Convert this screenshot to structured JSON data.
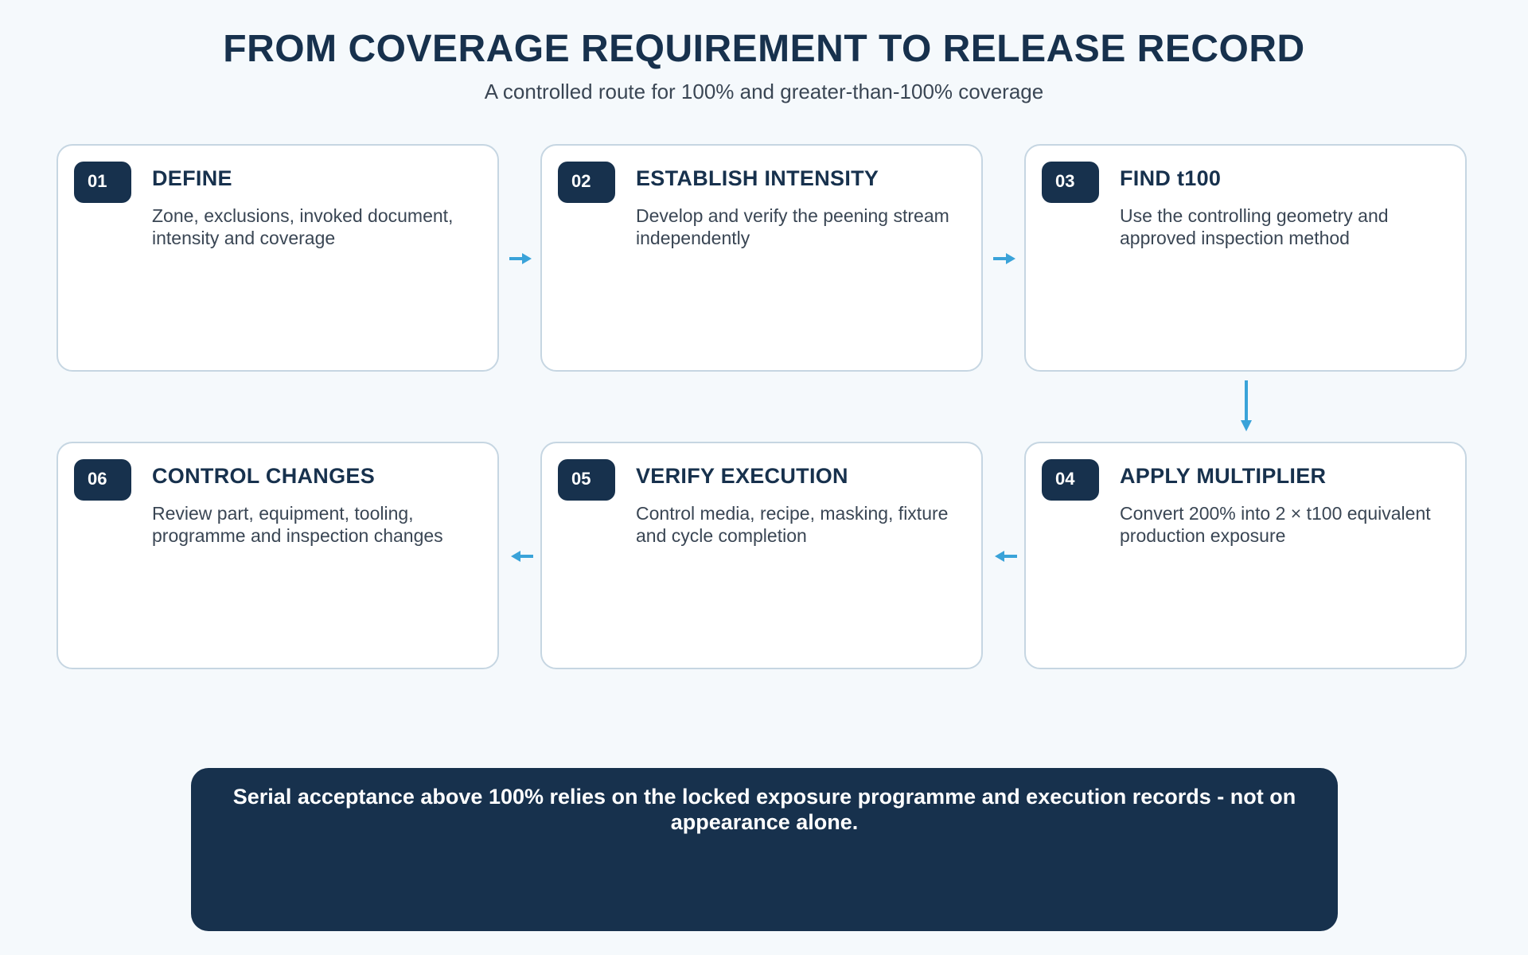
{
  "header": {
    "title": "FROM COVERAGE REQUIREMENT TO RELEASE RECORD",
    "subtitle": "A controlled route for 100% and greater-than-100% coverage"
  },
  "steps": [
    {
      "number": "01",
      "title": "DEFINE",
      "description": "Zone, exclusions, invoked document, intensity and coverage"
    },
    {
      "number": "02",
      "title": "ESTABLISH INTENSITY",
      "description": "Develop and verify the peening stream independently"
    },
    {
      "number": "03",
      "title": "FIND t100",
      "description": "Use the controlling geometry and approved inspection method"
    },
    {
      "number": "04",
      "title": "APPLY MULTIPLIER",
      "description": "Convert 200% into 2 × t100 equivalent production exposure"
    },
    {
      "number": "05",
      "title": "VERIFY EXECUTION",
      "description": "Control media, recipe, masking, fixture and cycle completion"
    },
    {
      "number": "06",
      "title": "CONTROL CHANGES",
      "description": "Review part, equipment, tooling, programme and inspection changes"
    }
  ],
  "footer": {
    "note": "Serial acceptance above 100% relies on the locked exposure programme and execution records - not on appearance alone."
  },
  "colors": {
    "navy": "#17314d",
    "arrow": "#3aa3d9",
    "card_border": "#c6d6e2",
    "background": "#f5f9fc"
  }
}
